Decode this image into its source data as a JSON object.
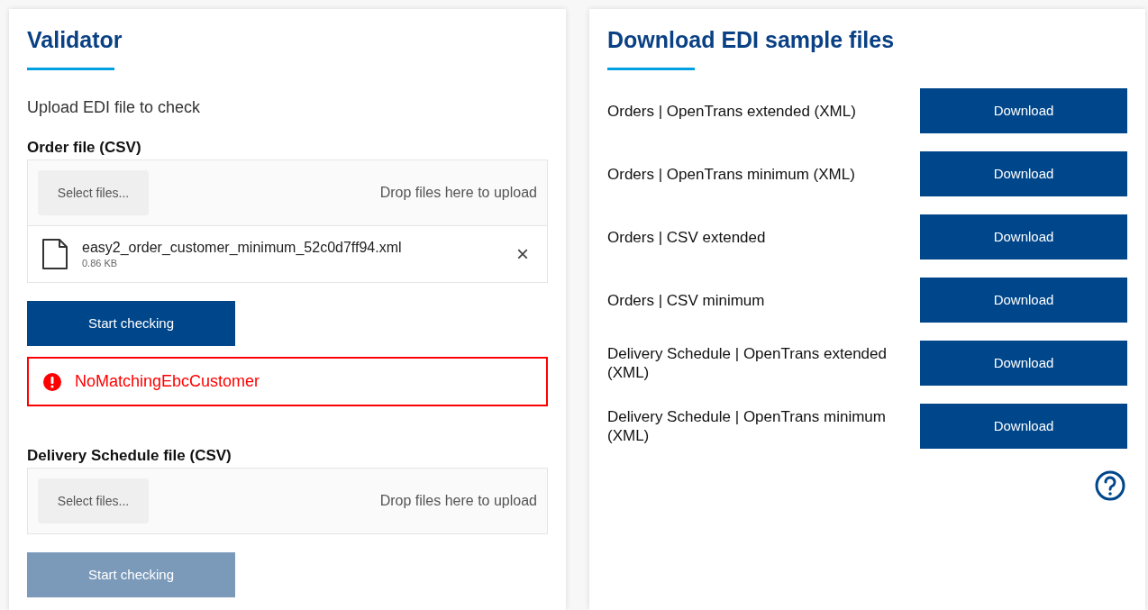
{
  "validator": {
    "title": "Validator",
    "subtitle": "Upload EDI file to check",
    "uploads": [
      {
        "label": "Order file (CSV)",
        "select_button": "Select files...",
        "drop_hint": "Drop files here to upload",
        "files": [
          {
            "name": "easy2_order_customer_minimum_52c0d7ff94.xml",
            "size": "0.86 KB",
            "remove": "×"
          }
        ],
        "check_button": {
          "label": "Start checking",
          "disabled": false
        },
        "error": "NoMatchingEbcCustomer"
      },
      {
        "label": "Delivery Schedule file (CSV)",
        "select_button": "Select files...",
        "drop_hint": "Drop files here to upload",
        "check_button": {
          "label": "Start checking",
          "disabled": true
        }
      }
    ]
  },
  "samples": {
    "title": "Download EDI sample files",
    "items": [
      {
        "label": "Orders | OpenTrans extended (XML)",
        "button": "Download"
      },
      {
        "label": "Orders | OpenTrans minimum (XML)",
        "button": "Download"
      },
      {
        "label": "Orders | CSV extended",
        "button": "Download"
      },
      {
        "label": "Orders | CSV minimum",
        "button": "Download"
      },
      {
        "label": "Delivery Schedule | OpenTrans extended (XML)",
        "button": "Download"
      },
      {
        "label": "Delivery Schedule | OpenTrans minimum (XML)",
        "button": "Download"
      }
    ]
  }
}
